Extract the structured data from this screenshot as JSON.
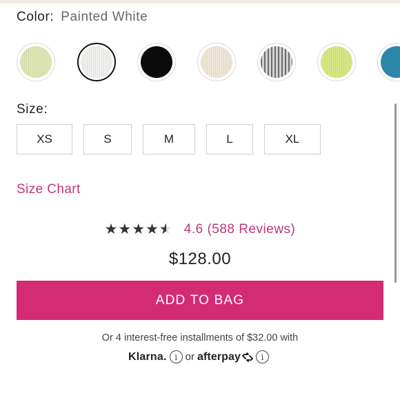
{
  "color": {
    "label": "Color:",
    "selected": "Painted White"
  },
  "swatches": [
    {
      "name": "Light Lime",
      "color": "#dfe8b3"
    },
    {
      "name": "Painted White",
      "color": "#f1f1ef",
      "selected": true
    },
    {
      "name": "Black",
      "color": "#0b0b0b"
    },
    {
      "name": "Cream",
      "color": "#efe8d9"
    },
    {
      "name": "Grey Stripe",
      "color": "#9e9e9e"
    },
    {
      "name": "Lime",
      "color": "#d9e886"
    },
    {
      "name": "Teal",
      "color": "#2f89ab"
    }
  ],
  "size": {
    "label": "Size:",
    "options": [
      "XS",
      "S",
      "M",
      "L",
      "XL"
    ]
  },
  "size_chart_link": "Size Chart",
  "rating": {
    "value": 4.6,
    "text": "4.6 (588 Reviews)"
  },
  "price": "$128.00",
  "add_to_bag_label": "ADD TO BAG",
  "installments_text": "Or 4 interest-free installments of $32.00 with",
  "payment": {
    "klarna": "Klarna.",
    "or": "or",
    "afterpay": "afterpay"
  },
  "colors": {
    "accent": "#d42c73",
    "link": "#c0357a"
  }
}
